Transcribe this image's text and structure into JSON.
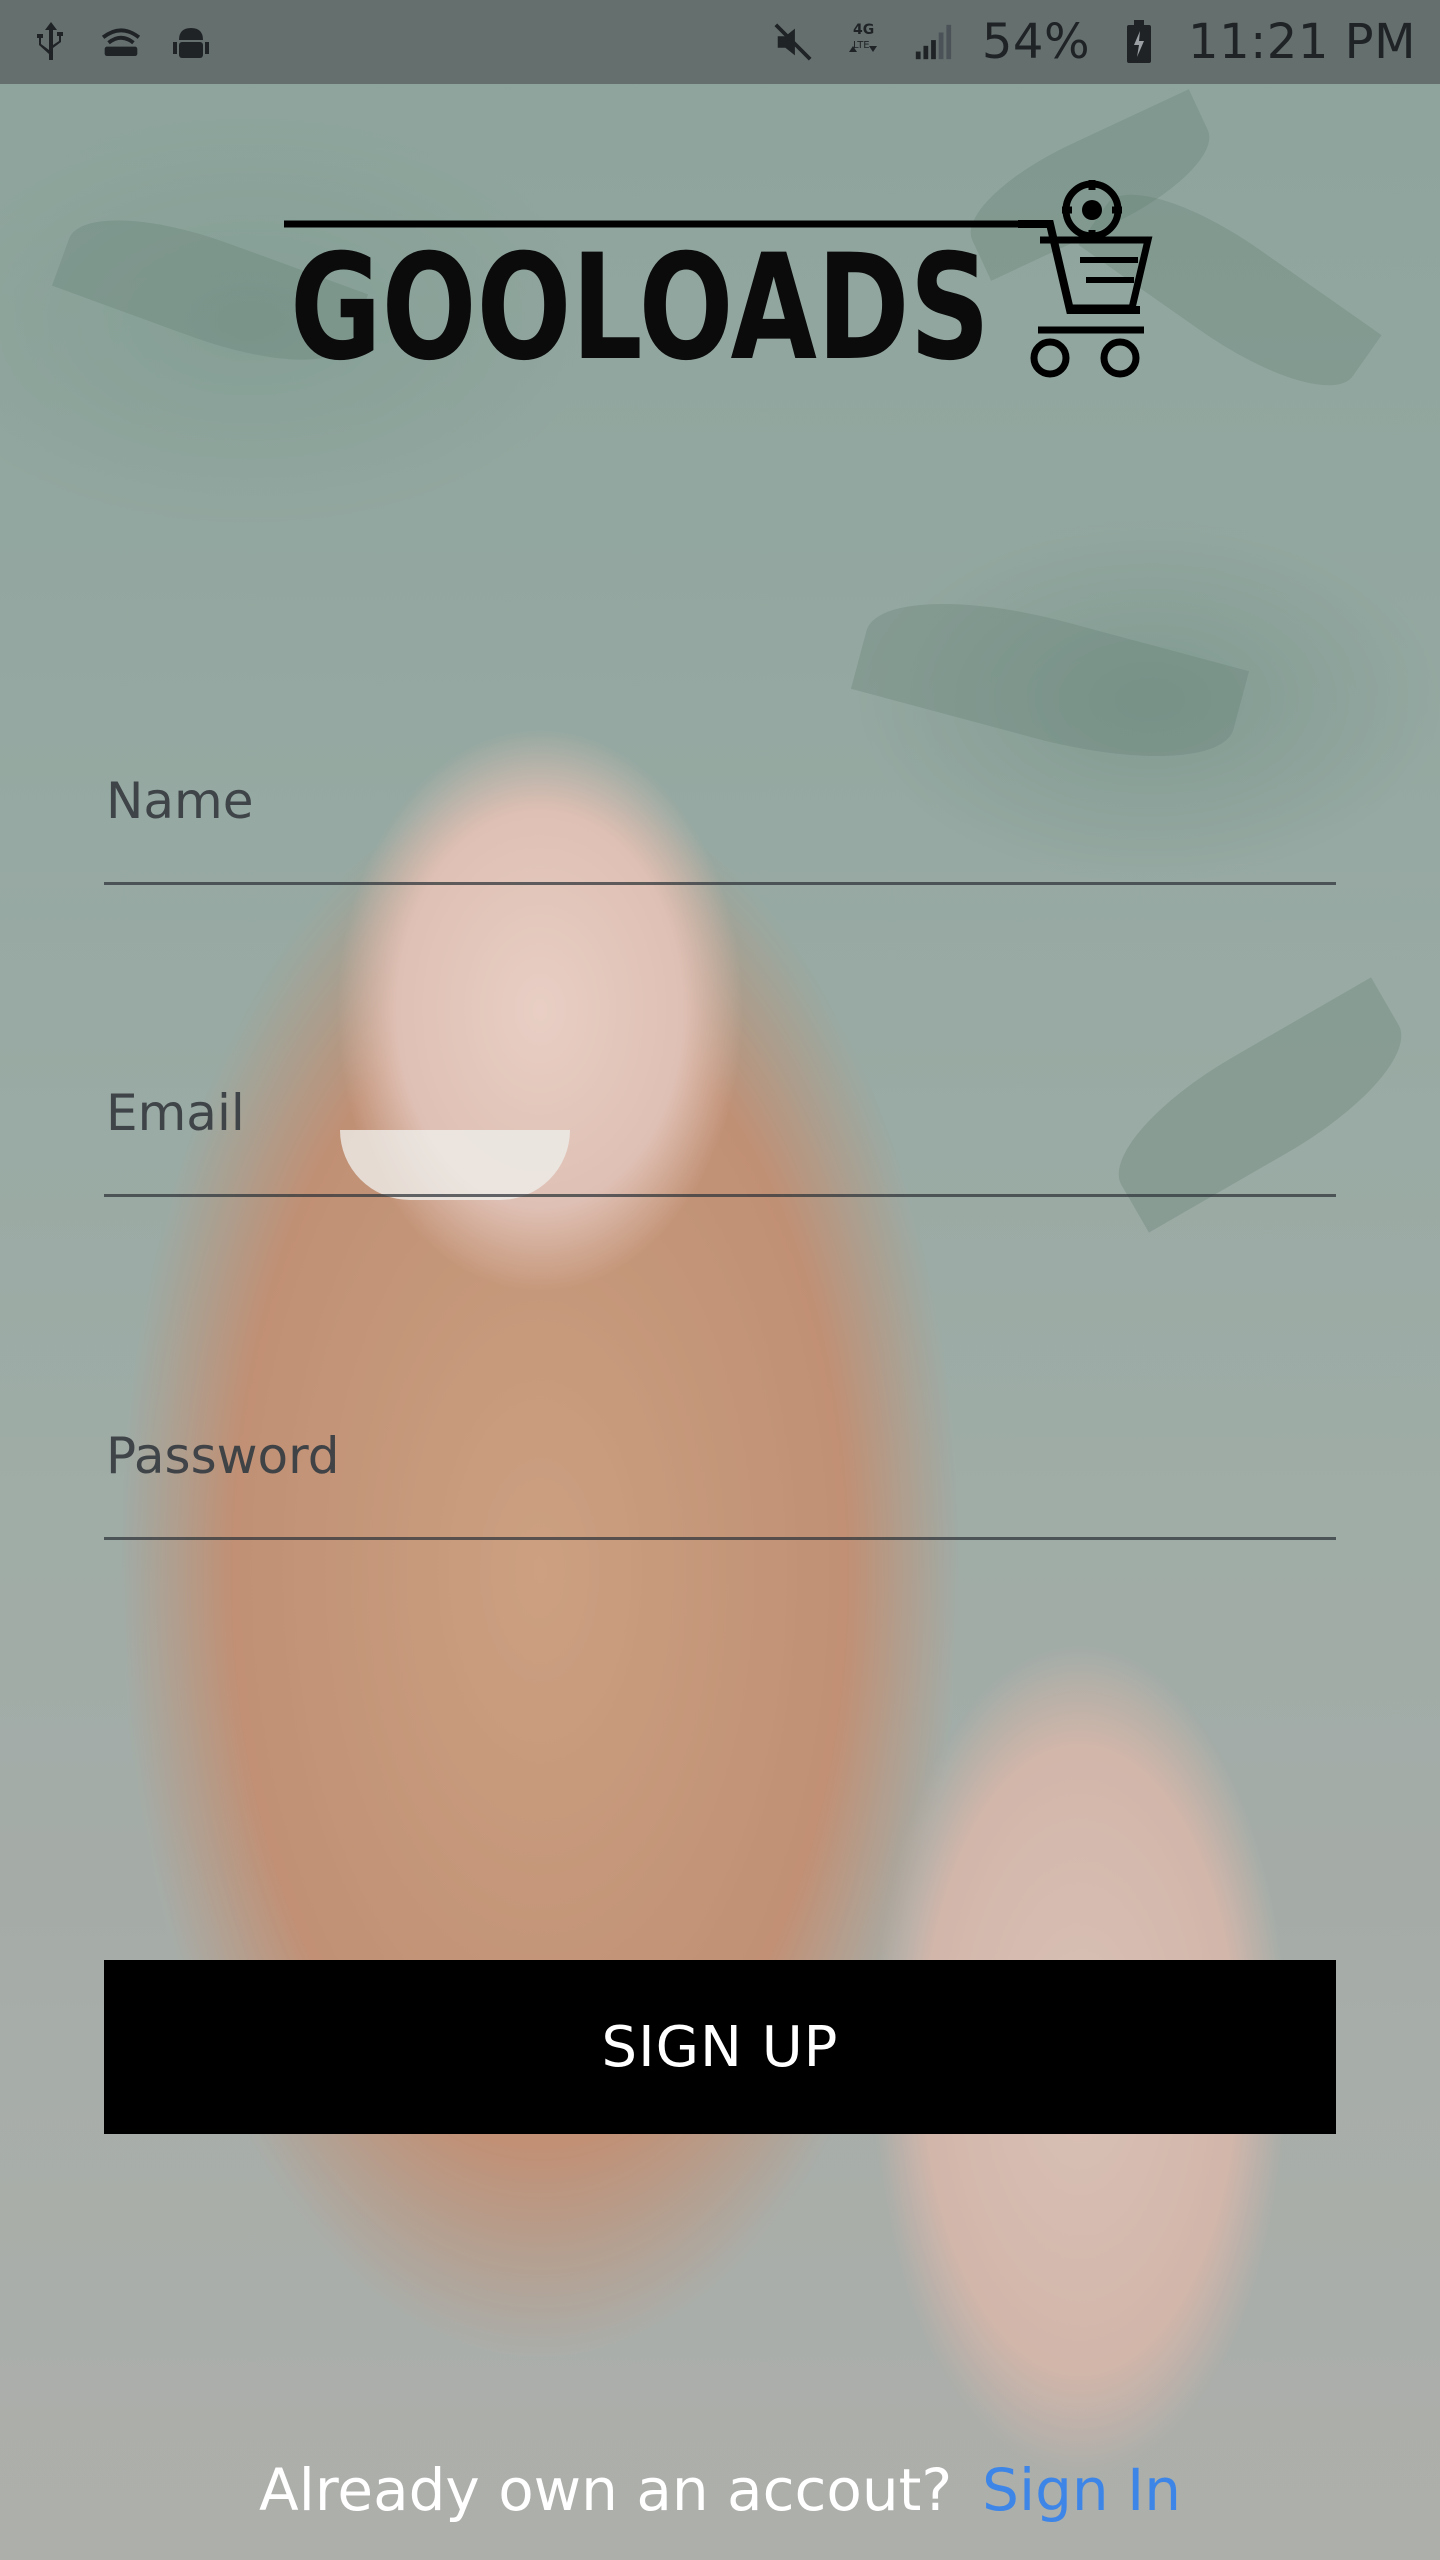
{
  "status_bar": {
    "battery": "54%",
    "time": "11:21 PM",
    "network_type": "4G LTE",
    "icons_left": [
      "usb-icon",
      "wifi-hotspot-icon",
      "android-debug-icon"
    ],
    "icons_right": [
      "mute-icon",
      "data-4g-lte-icon",
      "signal-icon",
      "battery-icon"
    ]
  },
  "logo": {
    "text": "GOOLOADS",
    "icon": "shopping-cart-gear-icon"
  },
  "form": {
    "name_placeholder": "Name",
    "email_placeholder": "Email",
    "password_placeholder": "Password",
    "name_value": "",
    "email_value": "",
    "password_value": ""
  },
  "signup_button": "SIGN UP",
  "footer": {
    "question": "Already own an accout?",
    "signin_link": "Sign In"
  },
  "colors": {
    "button_bg": "#000000",
    "button_text": "#ffffff",
    "link": "#3d86e8",
    "field_underline": "#33383c"
  }
}
